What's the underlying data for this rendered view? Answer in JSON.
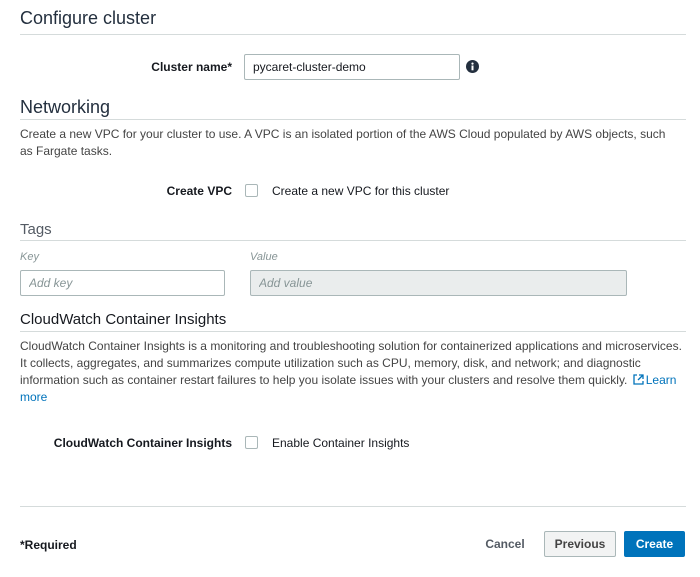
{
  "page": {
    "title": "Configure cluster"
  },
  "cluster": {
    "name_label": "Cluster name*",
    "name_value": "pycaret-cluster-demo",
    "info_icon": "info-icon"
  },
  "networking": {
    "title": "Networking",
    "description": "Create a new VPC for your cluster to use. A VPC is an isolated portion of the AWS Cloud populated by AWS objects, such as Fargate tasks.",
    "create_vpc_label": "Create VPC",
    "create_vpc_checkbox_label": "Create a new VPC for this cluster",
    "create_vpc_checked": false
  },
  "tags": {
    "title": "Tags",
    "key_header": "Key",
    "value_header": "Value",
    "key_placeholder": "Add key",
    "value_placeholder": "Add value"
  },
  "insights": {
    "title": "CloudWatch Container Insights",
    "description": "CloudWatch Container Insights is a monitoring and troubleshooting solution for containerized applications and microservices. It collects, aggregates, and summarizes compute utilization such as CPU, memory, disk, and network; and diagnostic information such as container restart failures to help you isolate issues with your clusters and resolve them quickly.",
    "learn_more": "Learn more",
    "external_link_icon": "external-link-icon",
    "field_label": "CloudWatch Container Insights",
    "checkbox_label": "Enable Container Insights",
    "checked": false
  },
  "footer": {
    "required_note": "*Required",
    "cancel_label": "Cancel",
    "previous_label": "Previous",
    "create_label": "Create"
  },
  "colors": {
    "primary": "#0073bb",
    "border": "#aab7b8",
    "divider": "#d5dbdb"
  }
}
